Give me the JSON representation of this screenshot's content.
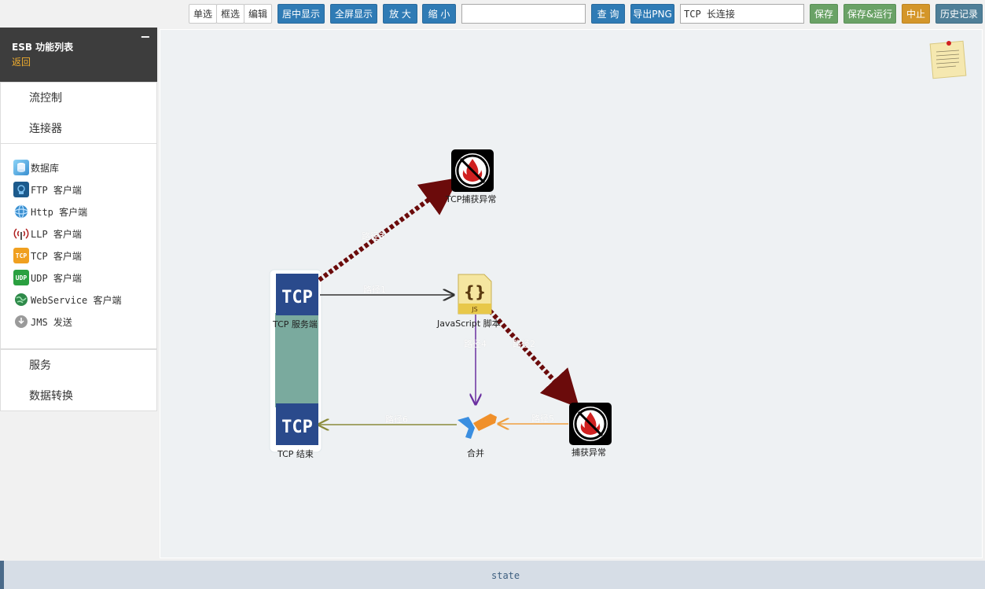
{
  "toolbar": {
    "single_select": "单选",
    "box_select": "框选",
    "edit": "编辑",
    "center_view": "居中显示",
    "fullscreen": "全屏显示",
    "zoom_in": "放 大",
    "zoom_out": "缩 小",
    "search_value": "",
    "search": "查 询",
    "export_png": "导出PNG",
    "flow_name": "TCP 长连接",
    "save": "保存",
    "save_run": "保存&运行",
    "stop": "中止",
    "history": "历史记录"
  },
  "sidebar": {
    "title": "ESB 功能列表",
    "back": "返回",
    "collapse_symbol": "−",
    "sections": {
      "flow_control": "流控制",
      "connectors": "连接器",
      "services": "服务",
      "data_transform": "数据转换"
    },
    "connectors": [
      {
        "label": "数据库",
        "icon": "database-icon"
      },
      {
        "label": "FTP 客户端",
        "icon": "ftp-icon"
      },
      {
        "label": "Http 客户端",
        "icon": "http-globe-icon"
      },
      {
        "label": "LLP 客户端",
        "icon": "llp-antenna-icon"
      },
      {
        "label": "TCP 客户端",
        "icon": "tcp-icon"
      },
      {
        "label": "UDP 客户端",
        "icon": "udp-icon"
      },
      {
        "label": "WebService 客户端",
        "icon": "webservice-globe-icon"
      },
      {
        "label": "JMS 发送",
        "icon": "jms-icon"
      }
    ]
  },
  "diagram": {
    "nodes": {
      "tcp_catch": "TCP捕获异常",
      "tcp_server": "TCP 服务端",
      "js_script": "JavaScript 脚本",
      "merge": "合并",
      "catch": "捕获异常",
      "tcp_end": "TCP 结束"
    },
    "node_icon_text": {
      "tcp": "TCP",
      "js": "JS"
    },
    "edges": {
      "e1": "路径1",
      "e2": "路径2",
      "e3": "路径3",
      "e4": "路径4",
      "e5": "路径5",
      "e6": "路径6"
    },
    "colors": {
      "exception_edge": "#6b0b0b",
      "normal_edge": "#333333",
      "js_to_merge": "#6a2fa0",
      "merge_to_end": "#8a8a3a",
      "catch_to_merge": "#f0a040",
      "tcp_blue": "#2a4a8c",
      "group_fill": "#7aaa9e"
    }
  },
  "status": {
    "text": "state"
  }
}
